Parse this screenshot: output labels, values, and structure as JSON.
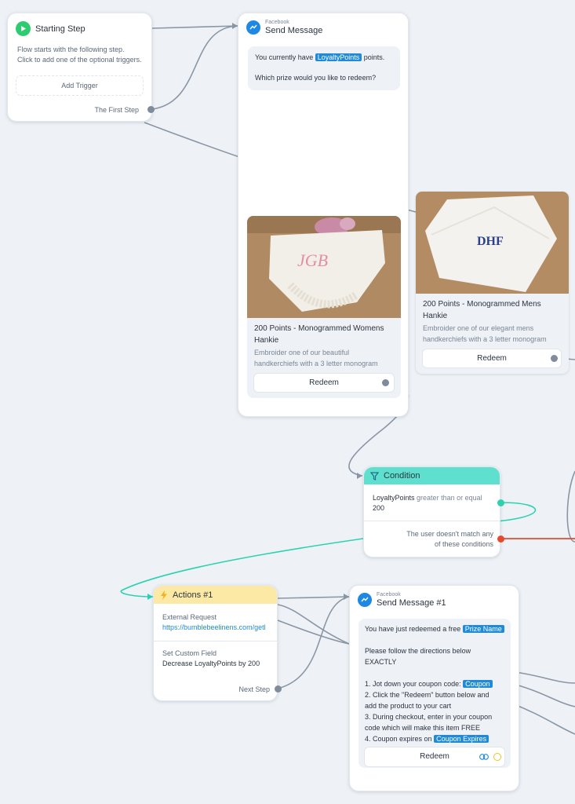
{
  "starting_step": {
    "title": "Starting Step",
    "desc_line1": "Flow starts with the following step.",
    "desc_line2": "Click to add one of the optional triggers.",
    "add_trigger": "Add Trigger",
    "first_step": "The First Step"
  },
  "send_message": {
    "channel": "Facebook",
    "title": "Send Message",
    "msg_pre": "You currently have",
    "msg_tag": "LoyaltyPoints",
    "msg_post": "points.",
    "msg_line2": "Which prize would you like to redeem?",
    "card1": {
      "title_line1": "200 Points - Monogrammed Womens",
      "title_line2": "Hankie",
      "desc_line1": "Embroider one of our beautiful",
      "desc_line2": "handkerchiefs with a 3 letter monogram",
      "button": "Redeem",
      "monogram": "JGB"
    },
    "card2": {
      "title_line1": "200 Points - Monogrammed Mens",
      "title_line2": "Hankie",
      "desc_line1": "Embroider one of our elegant mens",
      "desc_line2": "handkerchiefs with a 3 letter monogram",
      "button": "Redeem",
      "monogram": "DHF"
    }
  },
  "condition": {
    "title": "Condition",
    "field": "LoyaltyPoints",
    "op": "greater than or equal",
    "value": "200",
    "fallback_line1": "The user doesn't match any",
    "fallback_line2": "of these conditions"
  },
  "actions": {
    "title": "Actions #1",
    "req_label": "External Request",
    "req_url": "https://bumblebeelinens.com/getl",
    "field_label": "Set Custom Field",
    "field_value": "Decrease LoyaltyPoints by 200",
    "next_step": "Next Step"
  },
  "send_message_1": {
    "channel": "Facebook",
    "title": "Send Message #1",
    "line1_pre": "You have just redeemed a free",
    "line1_tag": "Prize Name",
    "line2": "Please follow the directions below",
    "line3": "EXACTLY",
    "step1_pre": "1. Jot down your coupon code:",
    "step1_tag": "Coupon",
    "step2a": "2. Click the \"Redeem\" button below and",
    "step2b": "add the product to your cart",
    "step3a": "3. During checkout, enter in your coupon",
    "step3b": "code which will make this item FREE",
    "step4_pre": "4. Coupon expires on",
    "step4_tag": "Coupon Expires",
    "button": "Redeem"
  },
  "colors": {
    "accent_blue": "#1f8ad8",
    "condition_teal": "#5fe0cf",
    "actions_yellow": "#fde9a6",
    "fallback_red": "#e64a2e",
    "start_green": "#2ecc71"
  }
}
